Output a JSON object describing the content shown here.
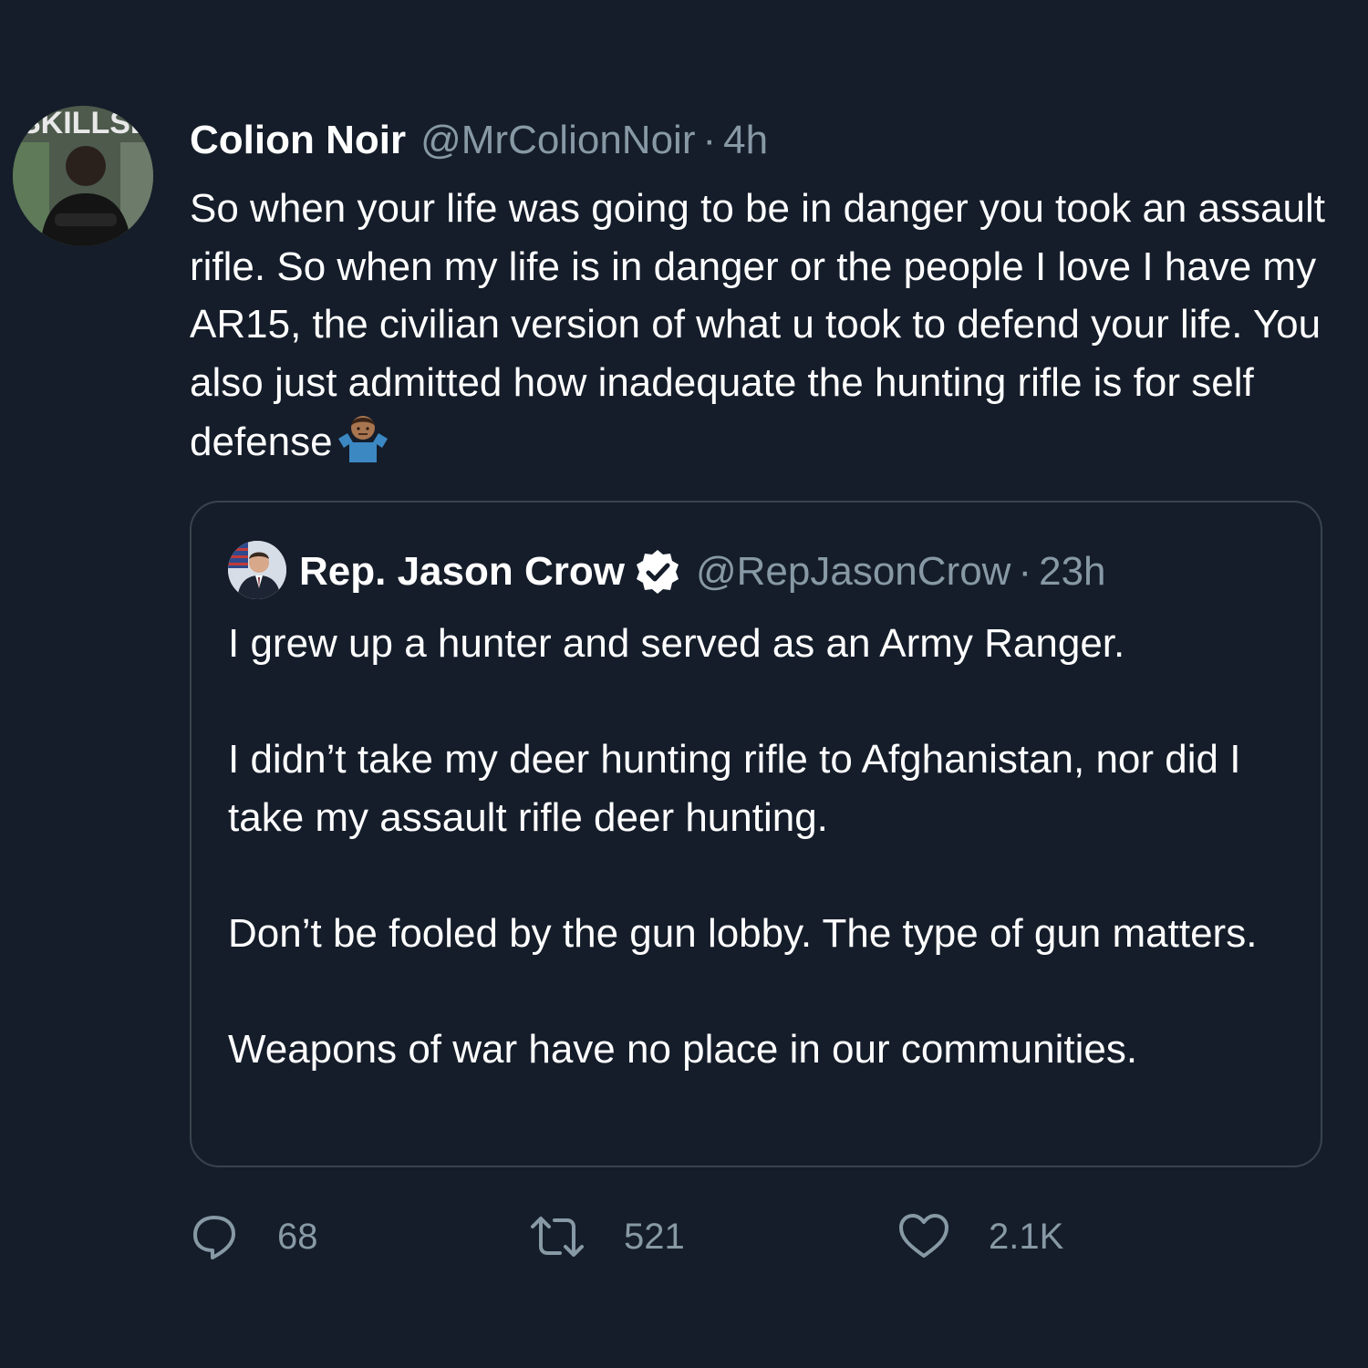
{
  "tweet": {
    "author_name": "Colion Noir",
    "author_handle": "@MrColionNoir",
    "separator": "·",
    "time": "4h",
    "avatar_icon": "person-avatar-magazine-cover",
    "avatar_text": "SKILLSET",
    "text": "So when your life was going to be in danger you took an assault rifle. So when my life is in danger or the people I love I have my AR15, the civilian version of what u took to defend your life. You also just admitted how inadequate the hunting rifle is for self defense",
    "emoji": "person-shrugging-emoji"
  },
  "quoted_tweet": {
    "author_name": "Rep. Jason Crow",
    "verified_icon": "verified-badge-icon",
    "author_handle": "@RepJasonCrow",
    "separator": "·",
    "time": "23h",
    "avatar_icon": "person-avatar-flag",
    "paragraphs": [
      "I grew up a hunter and served as an Army Ranger.",
      "I didn’t take my deer hunting rifle to Afghanistan, nor did I take my assault rifle deer hunting.",
      "Don’t be fooled by the gun lobby. The type of gun matters.",
      "Weapons of war have no place in our communities."
    ]
  },
  "actions": {
    "reply": {
      "icon": "reply-icon",
      "count": "68"
    },
    "retweet": {
      "icon": "retweet-icon",
      "count": "521"
    },
    "like": {
      "icon": "heart-icon",
      "count": "2.1K"
    }
  },
  "colors": {
    "background": "#151d2a",
    "text": "#ffffff",
    "muted": "#8899a6",
    "border": "#38444d"
  }
}
